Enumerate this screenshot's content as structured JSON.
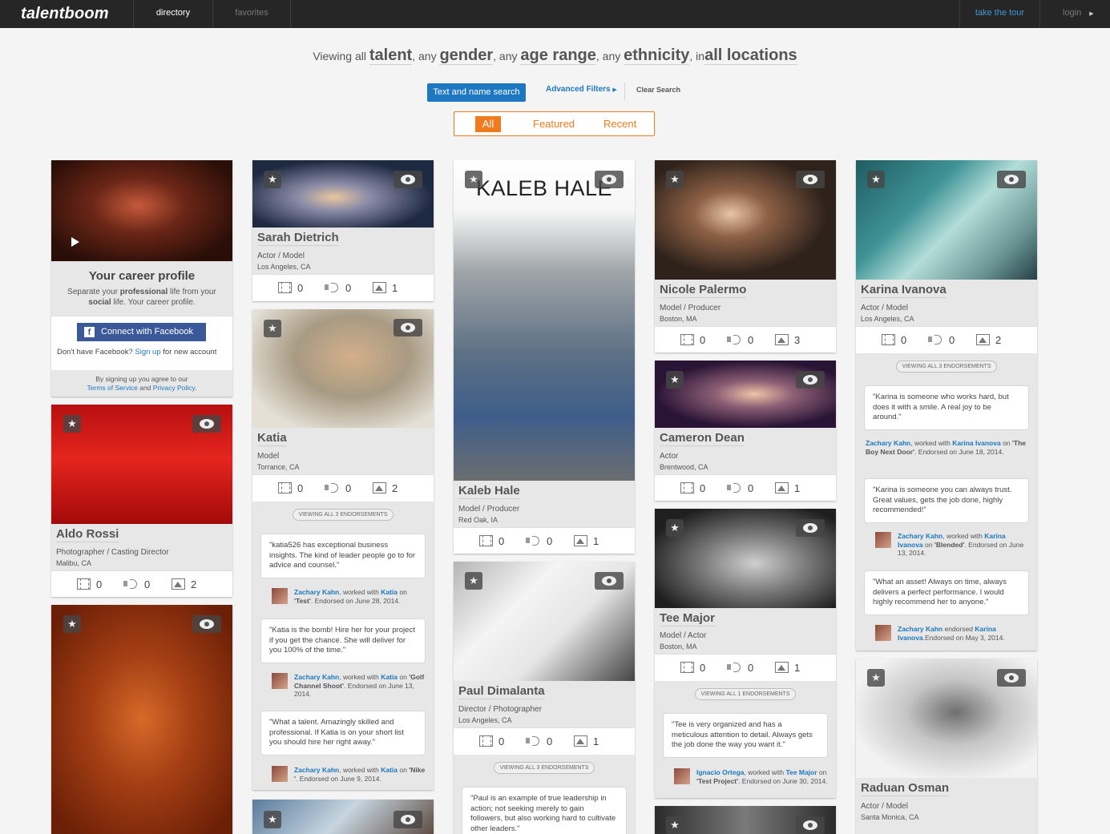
{
  "nav": {
    "logo": "talentboom",
    "tabs": [
      "directory",
      "favorites"
    ],
    "tour": "take the tour",
    "login": "login"
  },
  "headline": {
    "viewing": "Viewing all",
    "talent": "talent",
    "any1": ", any",
    "gender": "gender",
    "any2": ", any",
    "age": "age range",
    "any3": ", any",
    "ethnicity": "ethnicity",
    "in": ", in",
    "locations": "all locations"
  },
  "search": {
    "text_button": "Text and name search",
    "advanced": "Advanced Filters",
    "clear": "Clear Search"
  },
  "filter_tabs": [
    "All",
    "Featured",
    "Recent"
  ],
  "promo": {
    "title": "Your career profile",
    "text_a": "Separate your",
    "text_b": "professional",
    "text_c": "life from your",
    "text_d": "social",
    "text_e": "life. Your career profile.",
    "fb_button": "Connect with Facebook",
    "no_fb": "Don't have Facebook?",
    "signup": "Sign up",
    "signup_rest": "for new account",
    "terms_a": "By signing up you agree to our",
    "terms_link": "Terms of Service",
    "terms_and": "and",
    "privacy_link": "Privacy Policy",
    "terms_end": "."
  },
  "cards": {
    "sarah": {
      "name": "Sarah Dietrich",
      "role": "Actor / Model",
      "location": "Los Angeles, CA",
      "video": "0",
      "audio": "0",
      "images": "1"
    },
    "katia": {
      "name": "Katia",
      "role": "Model",
      "location": "Torrance, CA",
      "video": "0",
      "audio": "0",
      "images": "2",
      "endorsements": "VIEWING ALL 3 ENDORSEMENTS"
    },
    "kaleb": {
      "name": "Kaleb Hale",
      "photo_title": "KALEB HALE",
      "role": "Model / Producer",
      "location": "Red Oak, IA",
      "video": "0",
      "audio": "0",
      "images": "1"
    },
    "paul": {
      "name": "Paul Dimalanta",
      "role": "Director / Photographer",
      "location": "Los Angeles, CA",
      "video": "0",
      "audio": "0",
      "images": "1",
      "endorsements": "VIEWING ALL 3 ENDORSEMENTS"
    },
    "nicole": {
      "name": "Nicole Palermo",
      "role": "Model / Producer",
      "location": "Boston, MA",
      "video": "0",
      "audio": "0",
      "images": "3"
    },
    "cameron": {
      "name": "Cameron Dean",
      "role": "Actor",
      "location": "Brentwood, CA",
      "video": "0",
      "audio": "0",
      "images": "1"
    },
    "tee": {
      "name": "Tee Major",
      "role": "Model / Actor",
      "location": "Boston, MA",
      "video": "0",
      "audio": "0",
      "images": "1",
      "endorsements": "VIEWING ALL 1 ENDORSEMENTS"
    },
    "karina": {
      "name": "Karina Ivanova",
      "role": "Actor / Model",
      "location": "Los Angeles, CA",
      "video": "0",
      "audio": "0",
      "images": "2",
      "endorsements": "VIEWING ALL 3 ENDORSEMENTS"
    },
    "raduan": {
      "name": "Raduan Osman",
      "role": "Actor / Model",
      "location": "Santa Monica, CA"
    },
    "aldo": {
      "name": "Aldo Rossi",
      "role": "Photographer / Casting Director",
      "location": "Malibu, CA",
      "video": "0",
      "audio": "0",
      "images": "2"
    }
  },
  "quotes": {
    "katia1": "\"katia526 has exceptional business insights. The kind of leader people go to for advice and counsel.\"",
    "katia2": "\"Katia is the bomb! Hire her for your project if you get the chance. She will deliver for you 100% of the time.\"",
    "katia3": "\"What a talent. Amazingly skilled and professional. If Katia is on your short list you should hire her right away.\"",
    "paul1": "\"Paul is an example of true leadership in action; not seeking merely to gain followers, but also working hard to cultivate other leaders.\"",
    "tee1": "\"Tee is very organized and has a meticulous attention to detail. Always gets the job done the way you want it.\"",
    "karina1": "\"Karina is someone who works hard, but does it with a smile. A real joy to be around.\"",
    "karina2": "\"Karina is someone you can always trust. Great values, gets the job done, highly recommended!\"",
    "karina3": "\"What an asset! Always on time, always delivers a perfect performance. I would highly recommend her to anyone.\""
  },
  "bylines": {
    "zachary": "Zachary Kahn",
    "ignacio": "Ignacio Ortega",
    "worked_with": ", worked with",
    "endorsed": "endorsed",
    "on": "on",
    "katia": "Katia",
    "tee_major": "Tee Major",
    "karina_ivanova": "Karina Ivanova",
    "k1_project": "'Test'",
    "k1_date": ". Endorsed on June 28, 2014.",
    "k2_project": "'Golf Channel Shoot'",
    "k2_date": ". Endorsed on June 13, 2014.",
    "k3_project": "'Nike '",
    "k3_date": ". Endorsed on June 9, 2014.",
    "t1_project": "'Test Project'",
    "t1_date": ". Endorsed on June 30, 2014.",
    "r1_project": "'The Boy Next Door'",
    "r1_date": ". Endorsed on June 18, 2014.",
    "r2_project": "'Blended'",
    "r2_date": ". Endorsed on June 13, 2014.",
    "r3_date": ".Endorsed on May 3, 2014."
  }
}
